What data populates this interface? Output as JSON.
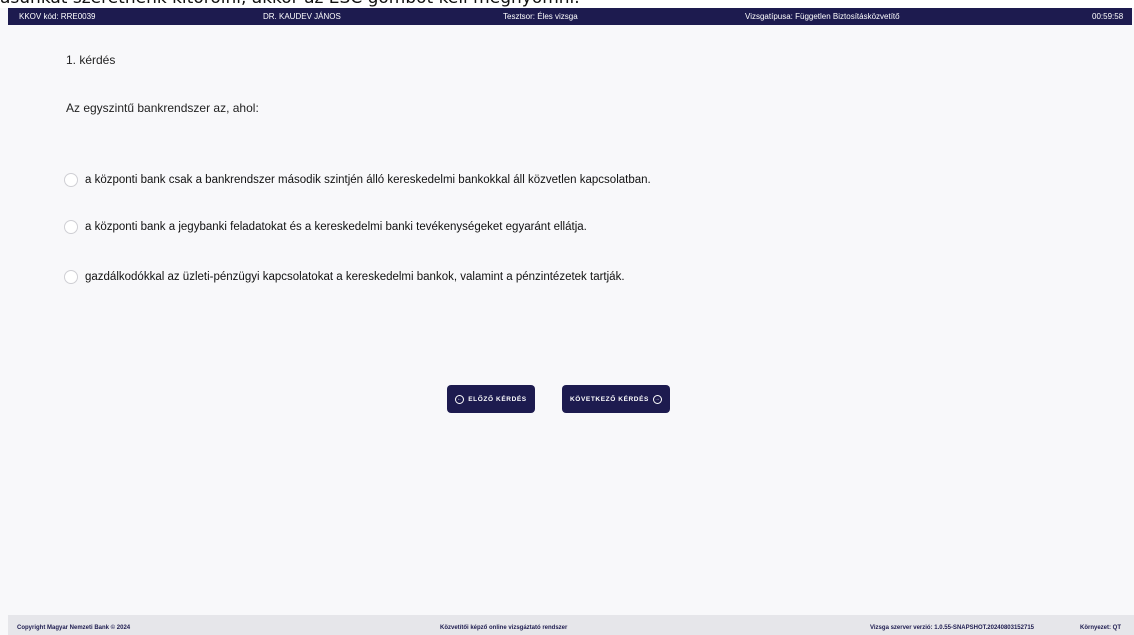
{
  "overlay": {
    "text": "ásunkat szeretnénk kitörölni, akkor az ESC gombot kell megnyomni."
  },
  "topbar": {
    "code": "KKOV kód: RRE0039",
    "user": "DR. KAUDEV JÁNOS",
    "test_type": "Tesztsor: Éles vizsga",
    "exam_type": "Vizsgatípusa: Független Biztosításközvetítő",
    "timer": "00:59:58"
  },
  "question": {
    "number": "1. kérdés",
    "text": "Az egyszintű bankrendszer az, ahol:",
    "answers": [
      "a központi bank csak a bankrendszer második szintjén álló kereskedelmi bankokkal áll közvetlen kapcsolatban.",
      "a központi bank a jegybanki feladatokat és a kereskedelmi banki tevékenységeket egyaránt ellátja.",
      "gazdálkodókkal az üzleti-pénzügyi kapcsolatokat a kereskedelmi bankok, valamint a pénzintézetek tartják."
    ]
  },
  "nav": {
    "prev_label": "ELŐZŐ KÉRDÉS",
    "next_label": "KÖVETKEZŐ KÉRDÉS",
    "prev_icon": "arrow-left-circle-icon",
    "next_icon": "arrow-right-circle-icon"
  },
  "footer": {
    "copyright": "Copyright Magyar Nemzeti Bank © 2024",
    "system": "Közvetítői képző online vizsgáztató rendszer",
    "version": "Vizsga szerver verzió: 1.0.55-SNAPSHOT.20240803152715",
    "environment": "Környezet: QT"
  },
  "colors": {
    "navy": "#1d1b4f",
    "background": "#f8f8fa",
    "footer": "#e6e6ea"
  }
}
